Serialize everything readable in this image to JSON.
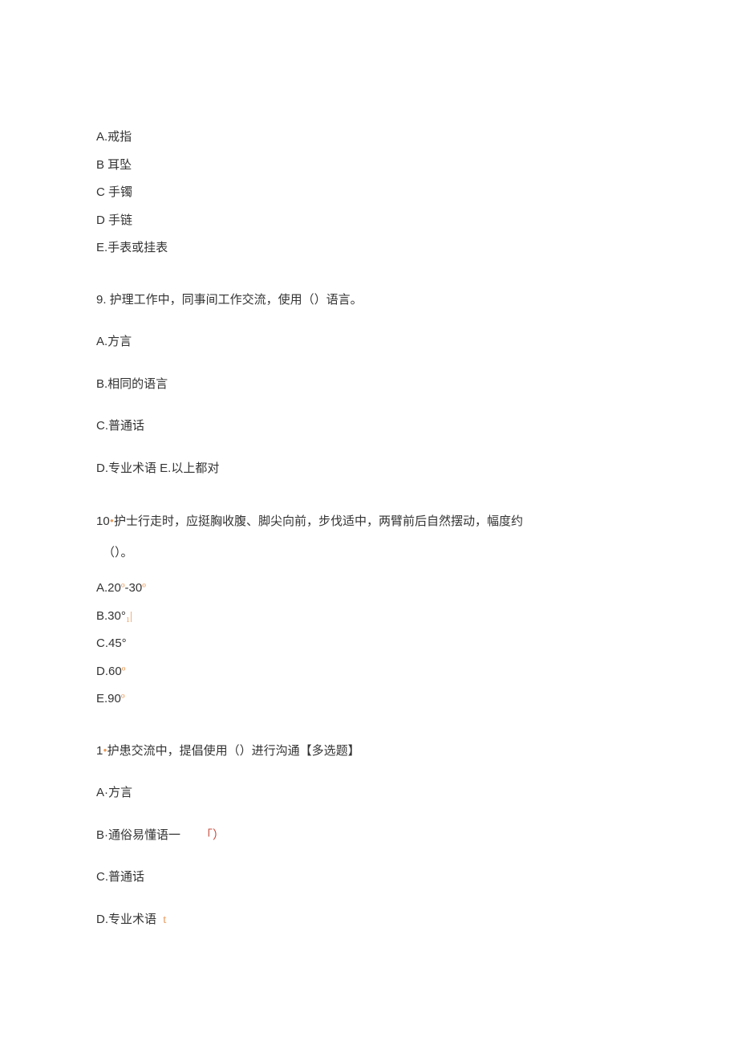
{
  "q8": {
    "A": "A.戒指",
    "B": "B 耳坠",
    "C": "C 手镯",
    "D": "D 手链",
    "E": "E.手表或挂表"
  },
  "q9": {
    "stem": "9. 护理工作中，同事间工作交流，使用（）语言。",
    "A": "A.方言",
    "B": "B.相同的语言",
    "C": "C.普通话",
    "D": "D.专业术语 E.以上都对"
  },
  "q10": {
    "prefix": "10",
    "bullet": "•",
    "stem_part1": "护士行走时，应挺胸收腹、脚尖向前，步伐适中，两臂前后自然摆动，幅度约",
    "stem_part2": "（）。",
    "A_pre": "A.20",
    "A_deg": "º",
    "A_mid": "-30",
    "A_deg2": "º",
    "B_pre": "B.30°",
    "B_sub": "₁|",
    "C": "C.45°",
    "D_pre": "D.60",
    "D_deg": "º",
    "E_pre": "E.90",
    "E_deg": "º"
  },
  "q1": {
    "prefix": "1",
    "bullet": "•",
    "stem": "护患交流中，提倡使用（）进行沟通",
    "tag": "【多选题】",
    "A": "A·方言",
    "B": "B·通俗易懂语一",
    "B_mark": "「）",
    "C": "C.普通话",
    "D": "D.专业术语",
    "D_mark": "t"
  }
}
